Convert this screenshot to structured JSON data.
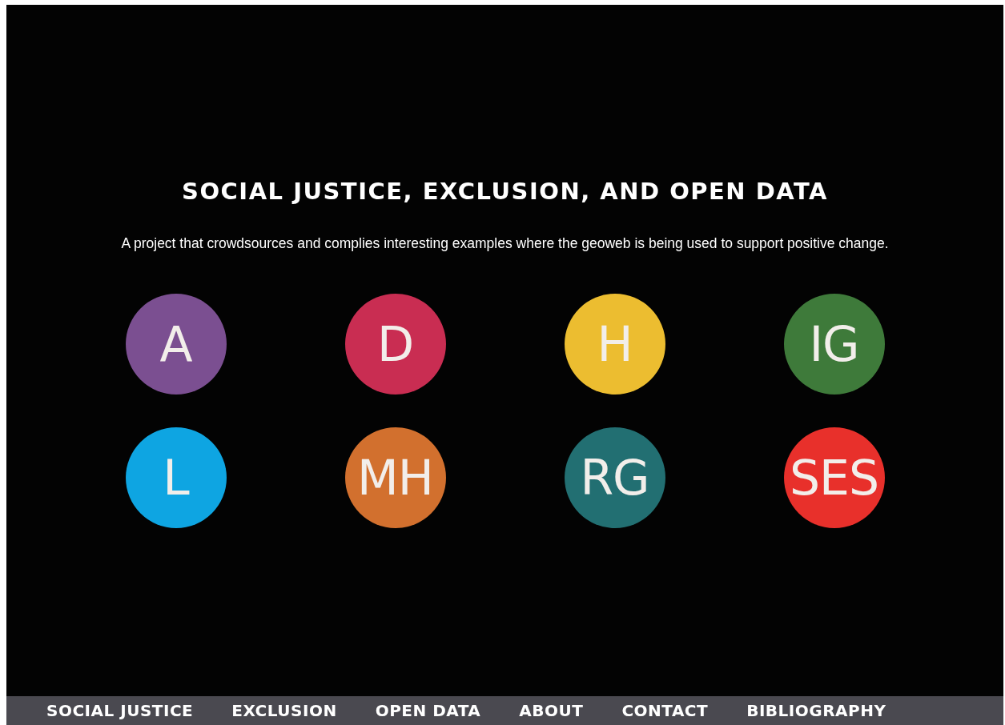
{
  "header": {
    "title": "SOCIAL JUSTICE, EXCLUSION, AND OPEN DATA",
    "subtitle": "A project that crowdsources and complies interesting examples where the geoweb is being used to support positive change."
  },
  "topics": [
    {
      "label": "A",
      "color": "#7b4f91"
    },
    {
      "label": "D",
      "color": "#c92d52"
    },
    {
      "label": "H",
      "color": "#ecbd30"
    },
    {
      "label": "IG",
      "color": "#3e7a3a"
    },
    {
      "label": "L",
      "color": "#0ea5e2"
    },
    {
      "label": "MH",
      "color": "#d2702e"
    },
    {
      "label": "RG",
      "color": "#226f72"
    },
    {
      "label": "SES",
      "color": "#e8302b"
    }
  ],
  "nav": [
    "SOCIAL JUSTICE",
    "EXCLUSION",
    "OPEN DATA",
    "ABOUT",
    "CONTACT",
    "BIBLIOGRAPHY"
  ]
}
